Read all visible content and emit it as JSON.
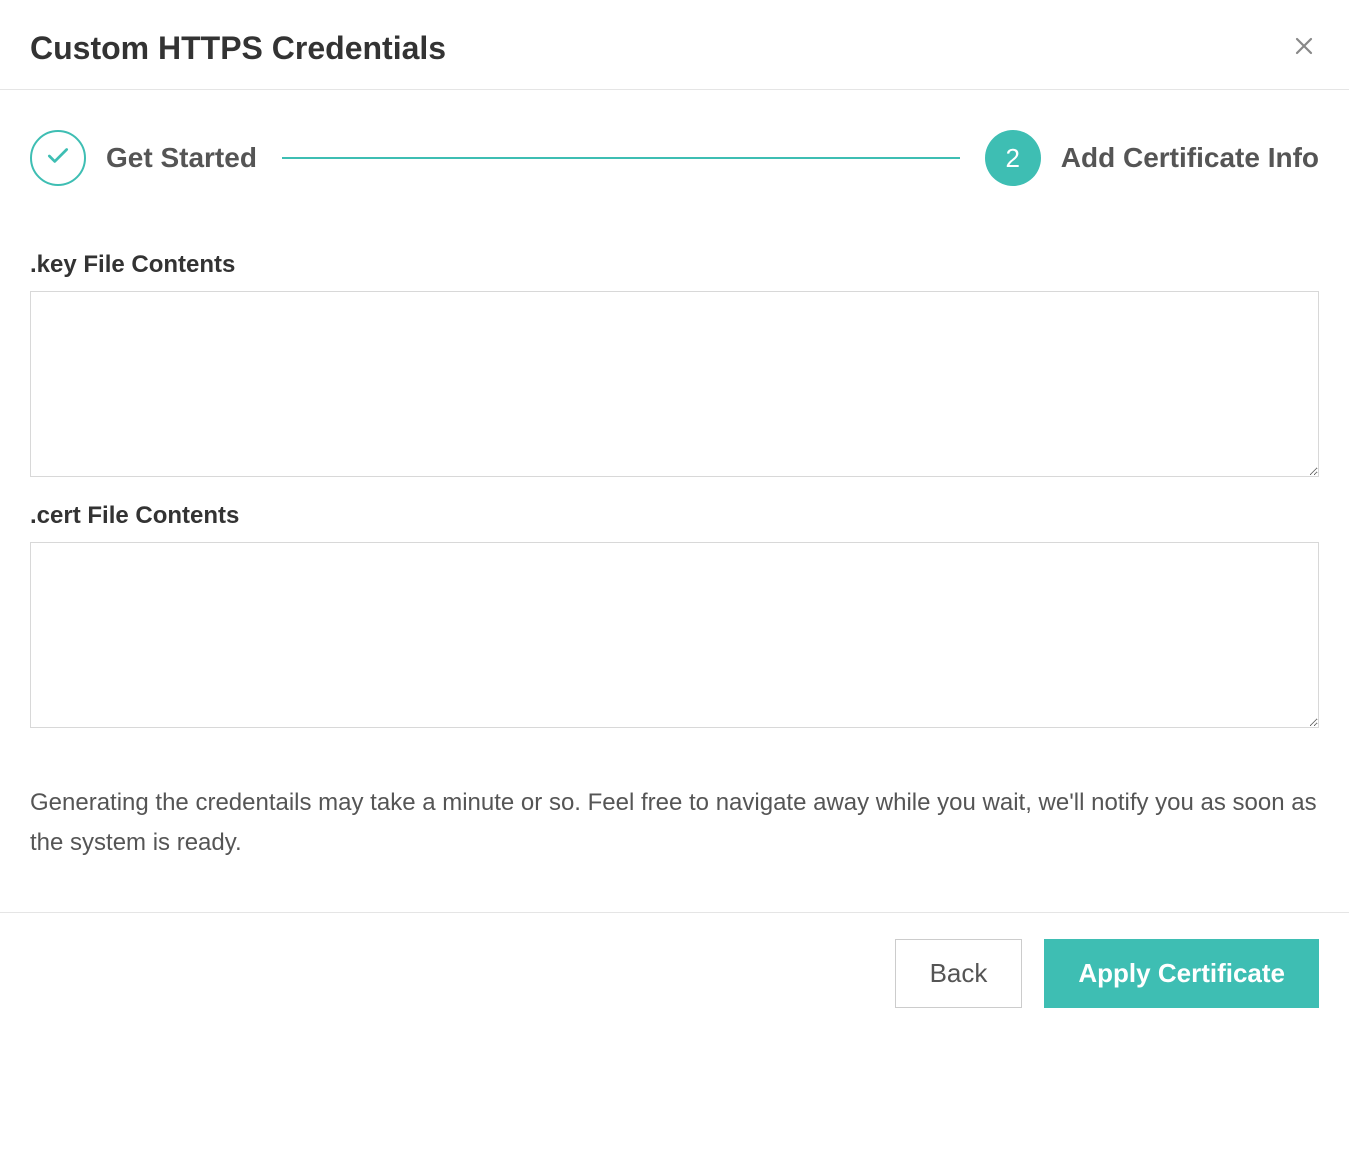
{
  "modal": {
    "title": "Custom HTTPS Credentials"
  },
  "stepper": {
    "step1": {
      "label": "Get Started",
      "completed": true
    },
    "step2": {
      "number": "2",
      "label": "Add Certificate Info",
      "active": true
    }
  },
  "form": {
    "keyLabel": ".key File Contents",
    "keyValue": "",
    "certLabel": ".cert File Contents",
    "certValue": ""
  },
  "infoText": "Generating the credentails may take a minute or so. Feel free to navigate away while you wait, we'll notify you as soon as the system is ready.",
  "footer": {
    "backLabel": "Back",
    "applyLabel": "Apply Certificate"
  }
}
